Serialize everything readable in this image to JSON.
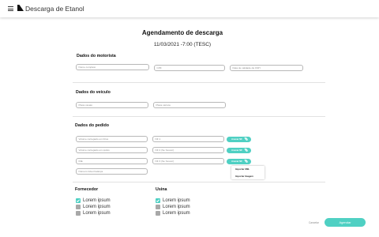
{
  "app": {
    "title": "Descarga de Etanol",
    "menu_icon": "hamburger-menu-icon",
    "logo_icon": "triangle-logo-icon"
  },
  "page": {
    "title": "Agendamento de descarga",
    "schedule": "11/03/2021 -7:00 (TESC)"
  },
  "driver": {
    "title": "Dados do motorista",
    "fields": [
      "Nome completo",
      "CPF",
      "Data de validade da CNH"
    ]
  },
  "vehicle": {
    "title": "Dados do veículo",
    "fields": [
      "Placa cavalo",
      "Placa carreta"
    ]
  },
  "order": {
    "title": "Dados do pedido",
    "fields": [
      "Volume carregado em litros",
      "NF 1",
      "Volume carregado em quilos",
      "NF 2 (Se houver)",
      "INE",
      "NF 3 (Se houver)",
      "Número ticket balança"
    ],
    "attach_label": "Anexar NF",
    "attach_icon": "paperclip-icon",
    "dropdown": [
      "Importar XML",
      "Importar Imagem"
    ]
  },
  "supplier": {
    "title": "Fornecedor",
    "items": [
      {
        "label": "Lorem ipsum",
        "checked": true
      },
      {
        "label": "Lorem ipsum",
        "checked": false
      },
      {
        "label": "Lorem ipsum",
        "checked": false
      }
    ]
  },
  "plant": {
    "title": "Usina",
    "items": [
      {
        "label": "Lorem ipsum",
        "checked": true
      },
      {
        "label": "Lorem ipsum",
        "checked": false
      },
      {
        "label": "Lorem ipsum",
        "checked": false
      }
    ]
  },
  "actions": {
    "cancel": "Cancelar",
    "submit": "Agendar"
  },
  "colors": {
    "accent": "#4fd0c3",
    "unchecked": "#a8a8a8"
  }
}
